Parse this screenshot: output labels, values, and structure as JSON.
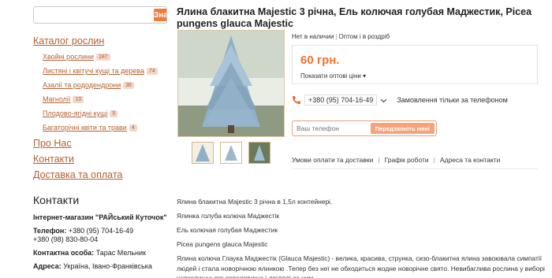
{
  "search": {
    "button_label": "Знайти",
    "value": ""
  },
  "sidebar": {
    "catalog_title": "Каталог рослин",
    "categories": [
      {
        "label": "Хвойні рослини",
        "count": "187"
      },
      {
        "label": "Листяні і квітучі кущі та дерева",
        "count": "74"
      },
      {
        "label": "Азалії та рододендрони",
        "count": "36"
      },
      {
        "label": "Магнолії",
        "count": "10"
      },
      {
        "label": "Плодово-ягідні кущі",
        "count": "5"
      },
      {
        "label": "Багаторічні квіти та трави",
        "count": "4"
      }
    ],
    "links": [
      "Про Нас",
      "Контакти",
      "Доставка та оплата"
    ]
  },
  "contacts": {
    "title": "Контакти",
    "shop": "Інтернет-магазин \"РАЙський Куточок\"",
    "phone_label": "Телефон:",
    "phone_1": "+380 (95) 704-16-49",
    "phone_2": "+380 (98) 830-80-04",
    "person_label": "Контактна особа:",
    "person": "Тарас Мельник",
    "address_label": "Адреса:",
    "address": "Україна, Івано-Франківська"
  },
  "product": {
    "title": "Ялина блакитна Majestic 3 річна, Ель колючая голубая Маджестик, Picea pungens glauca Majestic",
    "availability": "Нет в наличии",
    "sale_type": "Оптом і в роздріб",
    "price": "60 грн.",
    "wholesale_link": "Показати оптові ціни",
    "phone": "+380 (95) 704-16-49",
    "phone_note": "Замовлення тільки за телефоном",
    "callback_placeholder": "Ваш телефон",
    "callback_button": "Передзвоніть мені",
    "info_links": [
      "Умови оплати та доставки",
      "Графік роботи",
      "Адреса та контакти"
    ]
  },
  "description": [
    "Ялина блакитна Majestic 3 річна в 1,5л контейнері.",
    "Ялинка голуба колюча Маджестік",
    "Ель колючая голубая Маджестик",
    "Picea pungens glauca Majestic",
    "Ялина колюча Глаука Маджестік (Glauca Majestic) - велика, красива, струнка, сизо-блакитна ялина завоювала симпатії людей і стала новорічною ялинкою .Тепер без неї не обходиться жодне новорічне свято. Невибаглива рослина у виборі навколишнього середовища і догляді за ним."
  ],
  "colors": {
    "accent": "#ef7b3b",
    "link": "#b5602d",
    "price": "#f2732a"
  }
}
